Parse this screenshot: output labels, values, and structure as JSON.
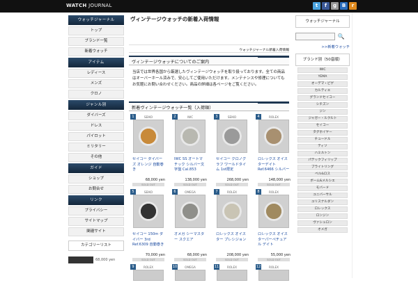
{
  "header": {
    "logo_bold": "WATCH",
    "logo_rest": " JOURNAL",
    "social": [
      {
        "icon": "twitter-icon",
        "label": "t",
        "color": "#4aa3df"
      },
      {
        "icon": "facebook-icon",
        "label": "f",
        "color": "#3b5998"
      },
      {
        "icon": "googleplus-icon",
        "label": "g",
        "color": "#999999"
      },
      {
        "icon": "hatena-icon",
        "label": "B",
        "color": "#2c6ebd"
      },
      {
        "icon": "rss-icon",
        "label": "r",
        "color": "#e08a1e"
      }
    ]
  },
  "left": {
    "sections": [
      {
        "head": "ウォッチジャーナル",
        "items": [
          "トップ",
          "ブランド一覧",
          "新着ウォッチ"
        ]
      },
      {
        "head": "アイテム",
        "items": [
          "レディース",
          "メンズ",
          "クロノ"
        ]
      },
      {
        "head": "ジャンル別",
        "items": [
          "ダイバーズ",
          "ドレス",
          "パイロット",
          "ミリタリー",
          "その他"
        ]
      },
      {
        "head": "ガイド",
        "items": [
          "ショップ",
          "お問合せ"
        ]
      },
      {
        "head": "リンク",
        "items": [
          "プライバシー",
          "サイトマップ",
          "関連サイト"
        ]
      }
    ],
    "box": "カテゴリーリスト",
    "thumb_text": "68,000 yen"
  },
  "main": {
    "title": "ヴィンテージウォッチの新着入荷情報",
    "banner": "ウォッチジャーナル新着入荷情報",
    "intro_head": "ヴィンテージウォッチについてのご案内",
    "intro": "当店では世界各国から厳選したヴィンテージウォッチを取り扱っております。全ての商品はオーバーホール済みで、安心してご使用いただけます。メンテナンスや修理についてもお気軽にお問い合わせください。商品の詳細は各ページをご覧ください。",
    "grid_head": "新着ヴィンテージウォッチ一覧（入荷順）",
    "products": [
      {
        "num": "1",
        "brand": "SEIKO",
        "name": "セイコー ダイバーズ オレンジ 自動巻き",
        "price": "68,000 yen",
        "sold": "SOLD OUT",
        "color": "#c88a3a"
      },
      {
        "num": "2",
        "brand": "IWC",
        "name": "IWC SS オートマチック シルバー文字盤 Cal.853",
        "price": "138,000 yen",
        "sold": "SOLD OUT",
        "color": "#b8b8b0"
      },
      {
        "num": "3",
        "brand": "SEIKO",
        "name": "セイコー クロノグラフ ワールドタイム 1st限定",
        "price": "268,000 yen",
        "sold": "SOLD OUT",
        "color": "#9a9a9a"
      },
      {
        "num": "4",
        "brand": "ROLEX",
        "name": "ロレックス オイスターデイト Ref.6466 シルバー",
        "price": "148,000 yen",
        "sold": "SOLD OUT",
        "color": "#a89070"
      },
      {
        "num": "5",
        "brand": "SEIKO",
        "name": "セイコー 150m ダイバー 3rd Ref.6309 自動巻き",
        "price": "70,000 yen",
        "sold": "SOLD OUT",
        "color": "#333333"
      },
      {
        "num": "6",
        "brand": "OMEGA",
        "name": "オメガ シーマスター スクエア",
        "price": "68,000 yen",
        "sold": "SOLD OUT",
        "color": "#8f8f8a"
      },
      {
        "num": "7",
        "brand": "ROLEX",
        "name": "ロレックス オイスター プレシジョン",
        "price": "208,000 yen",
        "sold": "SOLD OUT",
        "color": "#c9c4b4"
      },
      {
        "num": "8",
        "brand": "ROLEX",
        "name": "ロレックス オイスターパーペチュアル デイト",
        "price": "55,000 yen",
        "sold": "SOLD OUT",
        "color": "#a08a60"
      }
    ],
    "next_brands": [
      "ROLEX",
      "OMEGA",
      "ROLEX",
      "ROLEX"
    ]
  },
  "right": {
    "box": "ウォッチジャーナル",
    "search_placeholder": "",
    "new_link": ">>新着ウォッチ",
    "brand_head": "ブランド別（50音順）",
    "tags": [
      "IWC",
      "YEMA",
      "オーデマ・ピゲ",
      "カルティエ",
      "グランドセイコー",
      "シチズン",
      "ジン",
      "ジャガー・ルクルト",
      "セイコー",
      "タグホイヤー",
      "チュードル",
      "ティソ",
      "ハミルトン",
      "パテックフィリップ",
      "ブライトリング",
      "ベル&ロス",
      "ボーム&メルシエ",
      "モバード",
      "ユニバーサル",
      "ユリスナルダン",
      "ロレックス",
      "ロンジン",
      "ヴァシュロン",
      "オメガ"
    ]
  }
}
